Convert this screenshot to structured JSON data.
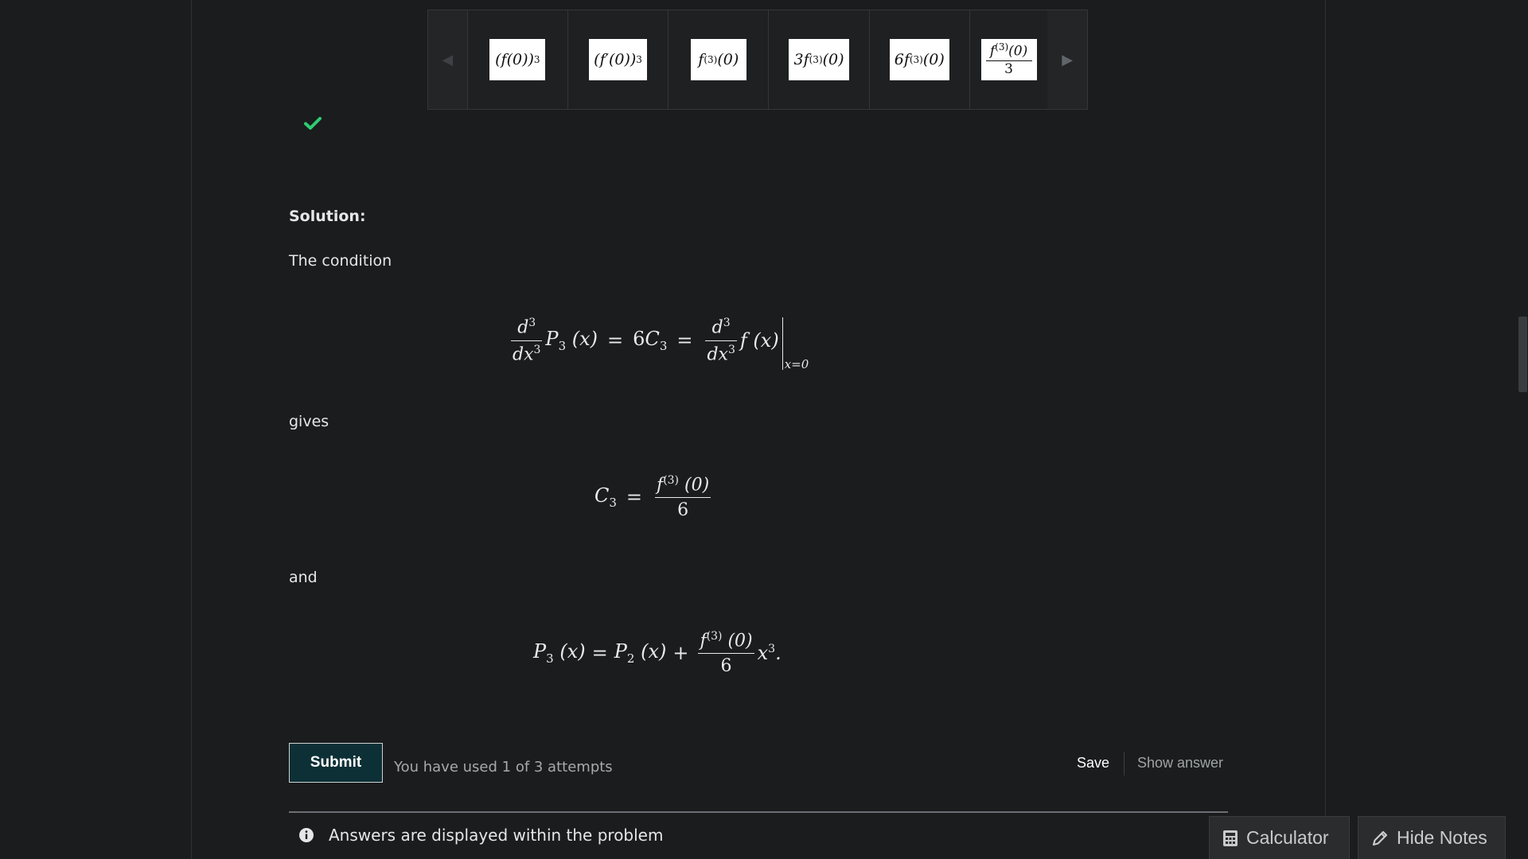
{
  "carousel": {
    "prev_icon": "triangle-left-icon",
    "next_icon": "triangle-right-icon",
    "options": [
      {
        "id": "opt1",
        "latex": "(f(0))^3"
      },
      {
        "id": "opt2",
        "latex": "(f'(0))^3"
      },
      {
        "id": "opt3",
        "latex": "f^{(3)}(0)"
      },
      {
        "id": "opt4",
        "latex": "3f^{(3)}(0)"
      },
      {
        "id": "opt5",
        "latex": "6f^{(3)}(0)"
      },
      {
        "id": "opt6",
        "latex": "\\frac{f^{(3)}(0)}{3}"
      }
    ]
  },
  "status": {
    "icon": "checkmark-icon",
    "color": "#2ecc71"
  },
  "solution": {
    "heading": "Solution:",
    "intro": "The condition",
    "gives": "gives",
    "and": "and",
    "eq1_latex": "\\frac{d^3}{dx^3}P_3(x) = 6C_3 = \\frac{d^3}{dx^3}f(x)\\Big|_{x=0}",
    "eq2_latex": "C_3 = \\frac{f^{(3)}(0)}{6}",
    "eq3_latex": "P_3(x) = P_2(x) + \\frac{f^{(3)}(0)}{6}x^3."
  },
  "actions": {
    "submit_label": "Submit",
    "attempts_text": "You have used 1 of 3 attempts",
    "save_label": "Save",
    "show_answer_label": "Show answer"
  },
  "notice": {
    "icon": "info-icon",
    "text": "Answers are displayed within the problem"
  },
  "tools": {
    "calculator_label": "Calculator",
    "notes_label": "Hide Notes"
  },
  "colors": {
    "background": "#1b1c1d",
    "submit_bg": "#0c3036",
    "check": "#2ecc71"
  }
}
